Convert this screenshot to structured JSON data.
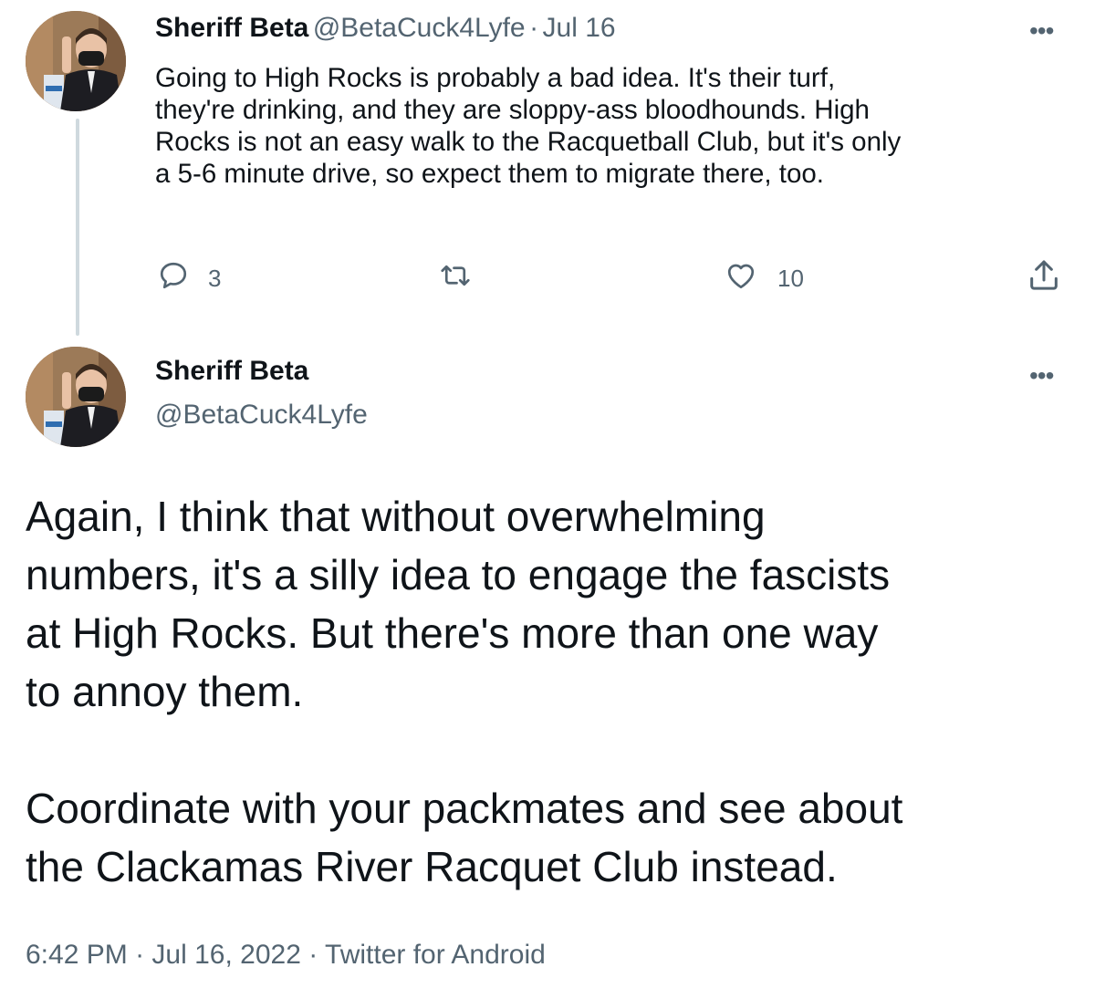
{
  "tweet1": {
    "display_name": "Sheriff Beta",
    "handle": "@BetaCuck4Lyfe",
    "separator": "·",
    "date": "Jul 16",
    "text": "Going to High Rocks is probably a bad idea.  It's their turf,\nthey're drinking, and they are sloppy-ass bloodhounds.  High\nRocks is not an easy walk to the Racquetball Club, but it's only\na 5-6 minute drive, so expect them to migrate there, too.",
    "reply_count": "3",
    "retweet_count": "",
    "like_count": "10",
    "more_label": "•••"
  },
  "tweet2": {
    "display_name": "Sheriff Beta",
    "handle": "@BetaCuck4Lyfe",
    "text": "Again, I think that without overwhelming\nnumbers, it's a silly idea to engage the fascists\nat High Rocks.  But there's more than one way\nto annoy them.\n\nCoordinate with your packmates and see about\nthe Clackamas River Racquet Club instead.",
    "time": "6:42 PM",
    "separator": "·",
    "date": "Jul 16, 2022",
    "source": "Twitter for Android",
    "more_label": "•••"
  },
  "icons": {
    "reply": "reply-icon",
    "retweet": "retweet-icon",
    "like": "like-icon",
    "share": "share-icon",
    "more": "more-icon"
  },
  "colors": {
    "text": "#0f1419",
    "secondary": "#536471",
    "thread_line": "#cfd9de"
  }
}
